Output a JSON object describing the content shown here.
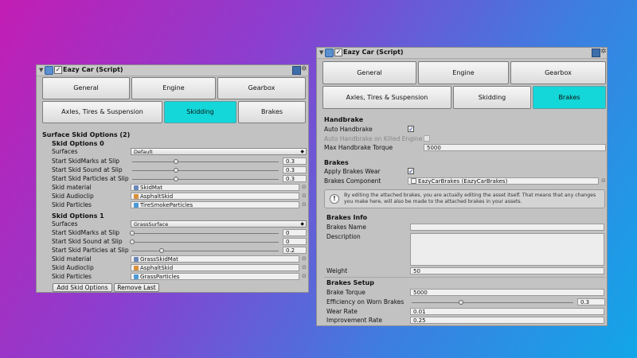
{
  "left_panel": {
    "title": "Eazy Car (Script)",
    "tabs_row1": [
      "General",
      "Engine",
      "Gearbox"
    ],
    "tabs_row2": [
      "Axles, Tires & Suspension",
      "Skidding",
      "Brakes"
    ],
    "active_tab": "Skidding",
    "section_title": "Surface Skid Options (2)",
    "skid_options": [
      {
        "heading": "Skid Options 0",
        "surfaces_label": "Surfaces",
        "surfaces_value": "Default",
        "marks_label": "Start SkidMarks at Slip",
        "marks_value": "0.3",
        "sound_label": "Start Skid Sound at Slip",
        "sound_value": "0.3",
        "particles_label": "Start Skid Particles at Slip",
        "particles_value": "0.3",
        "material_label": "Skid material",
        "material_value": "SkidMat",
        "audio_label": "Skid Audioclip",
        "audio_value": "AsphaltSkid",
        "part_label": "Skid Particles",
        "part_value": "TireSmokeParticles"
      },
      {
        "heading": "Skid Options 1",
        "surfaces_label": "Surfaces",
        "surfaces_value": "GrassSurface",
        "marks_label": "Start SkidMarks at Slip",
        "marks_value": "0",
        "sound_label": "Start Skid Sound at Slip",
        "sound_value": "0",
        "particles_label": "Start Skid Particles at Slip",
        "particles_value": "0.2",
        "material_label": "Skid material",
        "material_value": "GrassSkidMat",
        "audio_label": "Skid Audioclip",
        "audio_value": "AsphaltSkid",
        "part_label": "Skid Particles",
        "part_value": "GrassParticles"
      }
    ],
    "add_button": "Add Skid Options",
    "remove_button": "Remove Last"
  },
  "right_panel": {
    "title": "Eazy Car (Script)",
    "tabs_row1": [
      "General",
      "Engine",
      "Gearbox"
    ],
    "tabs_row2": [
      "Axles, Tires & Suspension",
      "Skidding",
      "Brakes"
    ],
    "active_tab": "Brakes",
    "handbrake": {
      "heading": "Handbrake",
      "auto_label": "Auto Handbrake",
      "auto_checked": true,
      "killed_label": "Auto Handbrake on Killed Engine",
      "killed_checked": false,
      "torque_label": "Max Handbrake Torque",
      "torque_value": "5000"
    },
    "brakes": {
      "heading": "Brakes",
      "wear_label": "Apply Brakes Wear",
      "wear_checked": true,
      "component_label": "Brakes Component",
      "component_value": "EazyCarBrakes (EazyCarBrakes)"
    },
    "help_text": "By editing the attached brakes, you are actually editing the asset itself. That means that any changes you make here, will also be made to the attached brakes in your assets.",
    "info": {
      "heading": "Brakes Info",
      "name_label": "Brakes Name",
      "name_value": "",
      "desc_label": "Description",
      "desc_value": "",
      "weight_label": "Weight",
      "weight_value": "50"
    },
    "setup": {
      "heading": "Brakes Setup",
      "torque_label": "Brake Torque",
      "torque_value": "5000",
      "efficiency_label": "Efficiency on Worn Brakes",
      "efficiency_value": "0.3",
      "wear_rate_label": "Wear Rate",
      "wear_rate_value": "0.01",
      "improve_label": "Improvement Rate",
      "improve_value": "0.25"
    }
  },
  "colors": {
    "active_tab": "#13d7d9",
    "panel": "#c2c2c2"
  },
  "icons": [
    "component-script-icon",
    "enabled-checkbox",
    "help-book-icon",
    "settings-gear-icon",
    "object-picker-icon",
    "info-icon"
  ]
}
